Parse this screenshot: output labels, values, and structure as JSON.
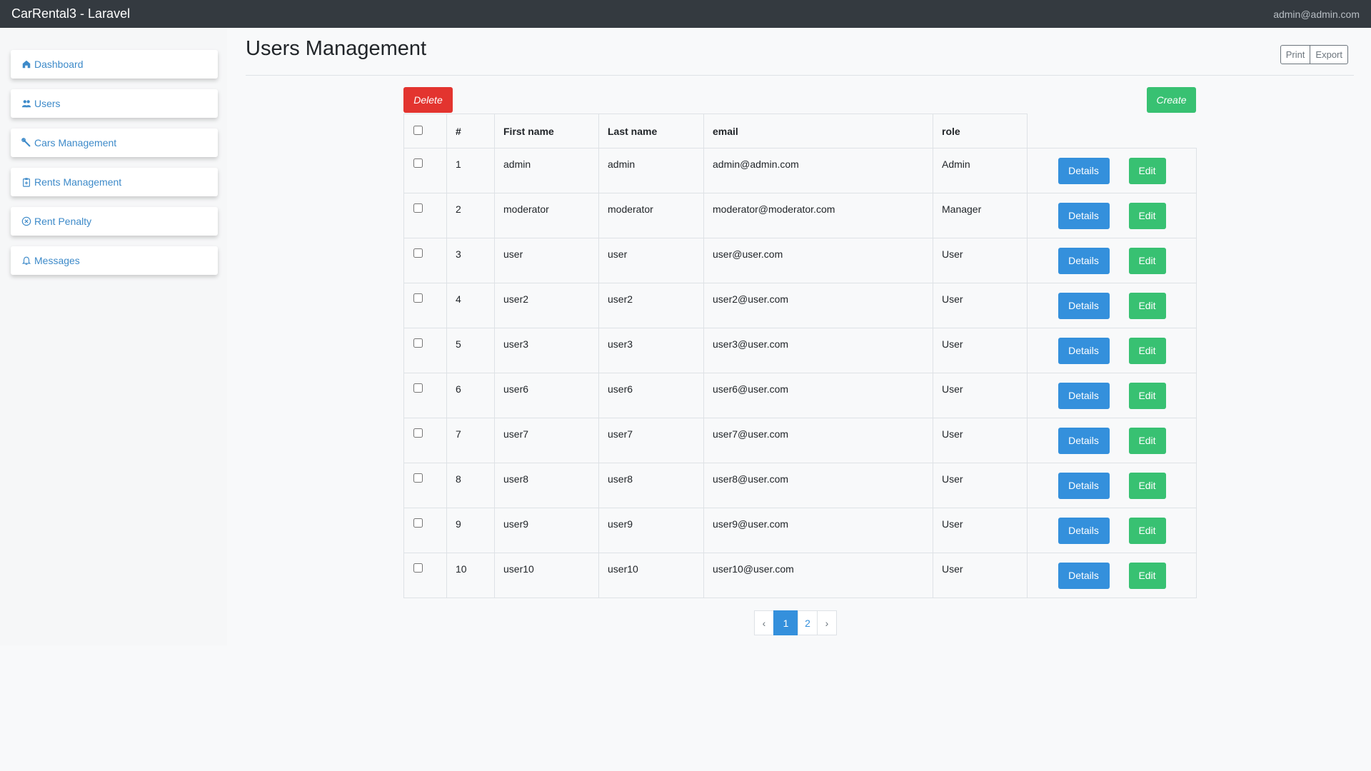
{
  "header": {
    "brand": "CarRental3 - Laravel",
    "user": "admin@admin.com"
  },
  "sidebar": {
    "items": [
      {
        "label": "Dashboard",
        "icon": "home-icon"
      },
      {
        "label": "Users",
        "icon": "users-icon"
      },
      {
        "label": "Cars Management",
        "icon": "wrench-icon"
      },
      {
        "label": "Rents Management",
        "icon": "clipboard-icon"
      },
      {
        "label": "Rent Penalty",
        "icon": "x-circle-icon"
      },
      {
        "label": "Messages",
        "icon": "bell-icon"
      }
    ]
  },
  "main": {
    "title": "Users Management",
    "toolbar": {
      "print_label": "Print",
      "export_label": "Export"
    },
    "delete_label": "Delete",
    "create_label": "Create",
    "table": {
      "headers": {
        "id": "#",
        "first_name": "First name",
        "last_name": "Last name",
        "email": "email",
        "role": "role"
      },
      "details_label": "Details",
      "edit_label": "Edit",
      "rows": [
        {
          "id": "1",
          "first_name": "admin",
          "last_name": "admin",
          "email": "admin@admin.com",
          "role": "Admin"
        },
        {
          "id": "2",
          "first_name": "moderator",
          "last_name": "moderator",
          "email": "moderator@moderator.com",
          "role": "Manager"
        },
        {
          "id": "3",
          "first_name": "user",
          "last_name": "user",
          "email": "user@user.com",
          "role": "User"
        },
        {
          "id": "4",
          "first_name": "user2",
          "last_name": "user2",
          "email": "user2@user.com",
          "role": "User"
        },
        {
          "id": "5",
          "first_name": "user3",
          "last_name": "user3",
          "email": "user3@user.com",
          "role": "User"
        },
        {
          "id": "6",
          "first_name": "user6",
          "last_name": "user6",
          "email": "user6@user.com",
          "role": "User"
        },
        {
          "id": "7",
          "first_name": "user7",
          "last_name": "user7",
          "email": "user7@user.com",
          "role": "User"
        },
        {
          "id": "8",
          "first_name": "user8",
          "last_name": "user8",
          "email": "user8@user.com",
          "role": "User"
        },
        {
          "id": "9",
          "first_name": "user9",
          "last_name": "user9",
          "email": "user9@user.com",
          "role": "User"
        },
        {
          "id": "10",
          "first_name": "user10",
          "last_name": "user10",
          "email": "user10@user.com",
          "role": "User"
        }
      ]
    },
    "pagination": {
      "prev": "‹",
      "pages": [
        "1",
        "2"
      ],
      "active": "1",
      "next": "›"
    }
  },
  "colors": {
    "primary": "#3490dc",
    "success": "#38c172",
    "danger": "#e3342f",
    "navbar": "#343a40",
    "link": "#3d8ac9"
  }
}
